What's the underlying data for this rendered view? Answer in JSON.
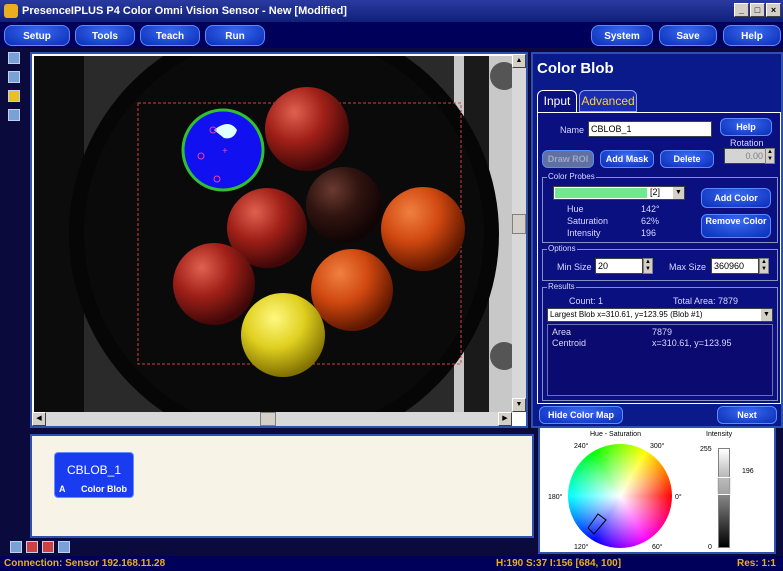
{
  "window": {
    "title": "PresenceIPLUS  P4 Color  Omni Vision Sensor - New [Modified]"
  },
  "menu": {
    "setup": "Setup",
    "tools": "Tools",
    "teach": "Teach",
    "run": "Run",
    "system": "System",
    "save": "Save",
    "help": "Help"
  },
  "panel": {
    "title": "Color Blob",
    "tab_input": "Input",
    "tab_advanced": "Advanced",
    "name_label": "Name",
    "name_value": "CBLOB_1",
    "help_btn": "Help",
    "rotation_label": "Rotation",
    "rotation_value": "0.00",
    "draw_roi": "Draw ROI",
    "add_mask": "Add Mask",
    "delete": "Delete",
    "probes_title": "Color Probes",
    "probe_selected": "[2]",
    "hue_label": "Hue",
    "hue_value": "142°",
    "sat_label": "Saturation",
    "sat_value": "62%",
    "int_label": "Intensity",
    "int_value": "196",
    "add_color": "Add Color",
    "remove_color": "Remove Color",
    "options_title": "Options",
    "min_size_label": "Min Size",
    "min_size_value": "20",
    "max_size_label": "Max Size",
    "max_size_value": "360960",
    "results_title": "Results",
    "count": "Count: 1",
    "total_area": "Total Area: 7879",
    "largest_blob": "Largest Blob   x=310.61, y=123.95  (Blob #1)",
    "area_label": "Area",
    "area_value": "7879",
    "centroid_label": "Centroid",
    "centroid_value": "x=310.61, y=123.95",
    "hide_map": "Hide Color Map",
    "next": "Next"
  },
  "colormap": {
    "hs_title": "Hue - Saturation",
    "int_title": "Intensity",
    "d240": "240°",
    "d300": "300°",
    "d180": "180°",
    "d0": "0°",
    "d120": "120°",
    "d60": "60°",
    "i255": "255",
    "i196": "196",
    "i0": "0"
  },
  "tool_chip": {
    "name": "CBLOB_1",
    "letter": "A",
    "type": "Color Blob"
  },
  "status": {
    "connection": "Connection: Sensor 192.168.11.28",
    "hsi": "H:190  S:37  I:156   [684, 100]",
    "res": "Res: 1:1"
  }
}
